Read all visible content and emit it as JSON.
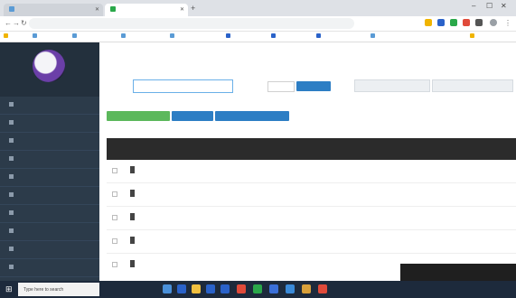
{
  "browser": {
    "tabs": [
      {
        "title": "",
        "active": false
      },
      {
        "title": "",
        "active": true
      }
    ],
    "address": "",
    "bookmarks": [
      "",
      "",
      "",
      "",
      "",
      "",
      "",
      "",
      "",
      ""
    ]
  },
  "sidebar": {
    "user_name": "",
    "items": [
      {
        "label": "",
        "icon": "home-icon"
      },
      {
        "label": "",
        "icon": "folder-icon"
      },
      {
        "label": "",
        "icon": "list-icon"
      },
      {
        "label": "",
        "icon": "file-icon"
      },
      {
        "label": "",
        "icon": "users-icon"
      },
      {
        "label": "",
        "icon": "chart-icon"
      },
      {
        "label": "",
        "icon": "settings-icon"
      },
      {
        "label": "",
        "icon": "link-icon"
      },
      {
        "label": "",
        "icon": "user-icon"
      },
      {
        "label": "",
        "icon": "book-icon"
      }
    ]
  },
  "main": {
    "breadcrumb": "",
    "right_link": "",
    "search_label": "",
    "search_value": "",
    "filter_label": "",
    "filter_select": "",
    "search_button": "",
    "action_buttons": [
      "",
      "",
      ""
    ],
    "grey_buttons": [
      "",
      ""
    ],
    "pager": "",
    "columns": [
      "",
      "",
      "",
      "",
      "",
      ""
    ],
    "rows": [
      {
        "title": "",
        "subtitle": "",
        "publisher": "",
        "status": "",
        "date": ""
      },
      {
        "title": "",
        "subtitle": "",
        "publisher": "",
        "status": "",
        "date": ""
      },
      {
        "title": "",
        "subtitle": "",
        "publisher": "",
        "status": "",
        "date": ""
      },
      {
        "title": "",
        "subtitle": "",
        "publisher": "",
        "status": "",
        "date": ""
      },
      {
        "title": "",
        "subtitle": "",
        "publisher": "",
        "status": "",
        "date": ""
      }
    ]
  },
  "toast": "",
  "taskbar": {
    "search_placeholder": "Type here to search",
    "time": "",
    "date": ""
  },
  "colors": {
    "sidebar_bg": "#2c3b4a",
    "accent": "#2d7ec4",
    "green": "#5cb85c",
    "status_red": "#e05a3a"
  }
}
